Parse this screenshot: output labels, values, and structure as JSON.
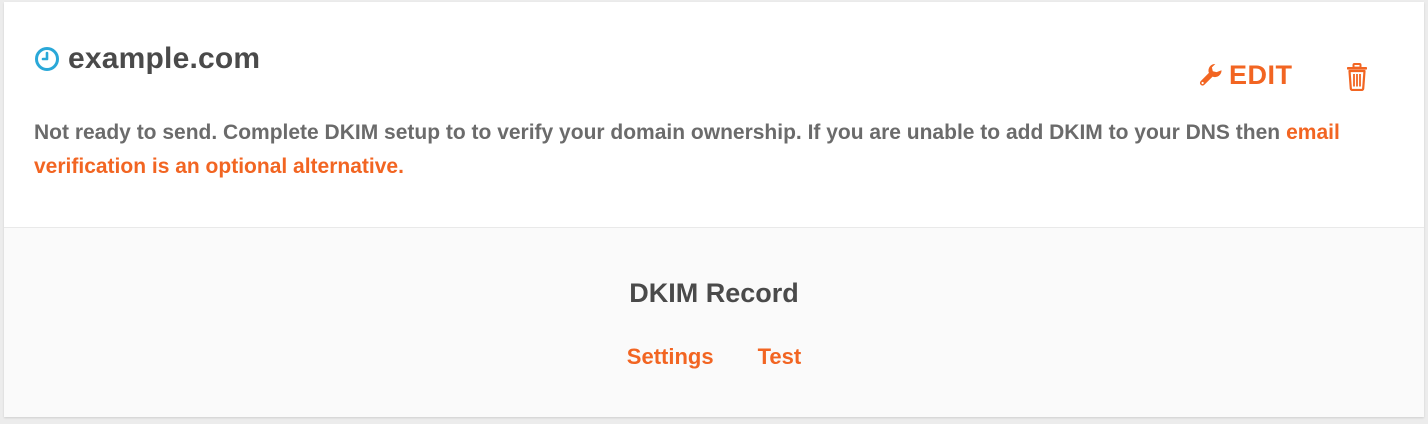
{
  "domain": {
    "name": "example.com",
    "status_icon": "clock-icon",
    "status_icon_color": "#2aa8d8"
  },
  "actions": {
    "edit_label": "EDIT",
    "edit_icon": "wrench-icon",
    "delete_icon": "trash-icon",
    "accent_color": "#f26522"
  },
  "status": {
    "message": "Not ready to send. Complete DKIM setup to to verify your domain ownership. If you are unable to add DKIM to your DNS then",
    "link_text": "email verification is an optional alternative."
  },
  "record": {
    "title": "DKIM Record",
    "links": [
      "Settings",
      "Test"
    ]
  }
}
